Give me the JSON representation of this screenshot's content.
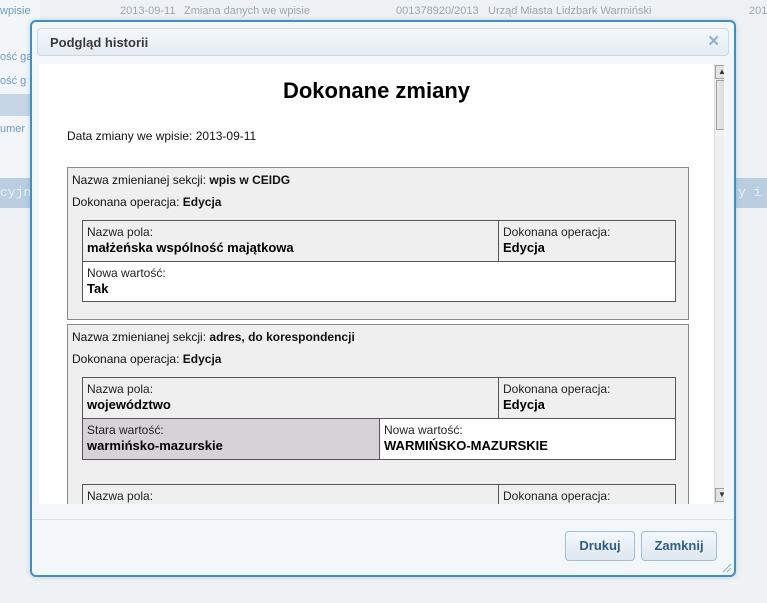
{
  "background": {
    "sidebar_items": [
      "wpisie",
      "ość ga",
      "ość ga",
      "ość g",
      "",
      "umer"
    ],
    "row": {
      "date": "2013-09-11",
      "desc": "Zmiana danych we wpisie",
      "num": "001378920/2013",
      "office": "Urząd Miasta Lidzbark Warmiński",
      "year": "201"
    },
    "band_left": "cyjn",
    "band_right": "y i"
  },
  "dialog": {
    "title": "Podgląd historii",
    "close_glyph": "✕",
    "heading": "Dokonane zmiany",
    "date_label": "Data zmiany we wpisie:",
    "date_value": "2013-09-11",
    "section_label": "Nazwa zmienianej sekcji:",
    "operation_label": "Dokonana operacja:",
    "field_label": "Nazwa pola:",
    "field_op_label": "Dokonana operacja:",
    "new_label": "Nowa wartość:",
    "old_label": "Stara wartość:",
    "sections": [
      {
        "name": "wpis w CEIDG",
        "operation": "Edycja",
        "field": {
          "name": "małżeńska wspólność majątkowa",
          "operation": "Edycja",
          "new": "Tak"
        }
      },
      {
        "name": "adres, do korespondencji",
        "operation": "Edycja",
        "field": {
          "name": "województwo",
          "operation": "Edycja",
          "old": "warmińsko-mazurskie",
          "new": "WARMIŃSKO-MAZURSKIE"
        },
        "field2": {
          "name": "",
          "operation": ""
        }
      }
    ],
    "buttons": {
      "print": "Drukuj",
      "close": "Zamknij"
    }
  }
}
